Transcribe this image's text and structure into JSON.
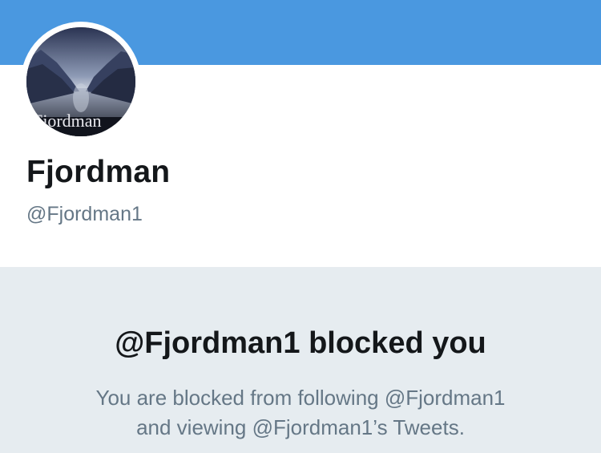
{
  "profile": {
    "display_name": "Fjordman",
    "handle": "@Fjordman1",
    "avatar_text": "Fjordman"
  },
  "blocked": {
    "title": "@Fjordman1 blocked you",
    "line1": "You are blocked from following @Fjordman1",
    "line2": "and viewing @Fjordman1’s Tweets."
  },
  "colors": {
    "banner": "#4a98e0",
    "panel": "#e6ecf0",
    "text_primary": "#14171a",
    "text_secondary": "#657786"
  }
}
